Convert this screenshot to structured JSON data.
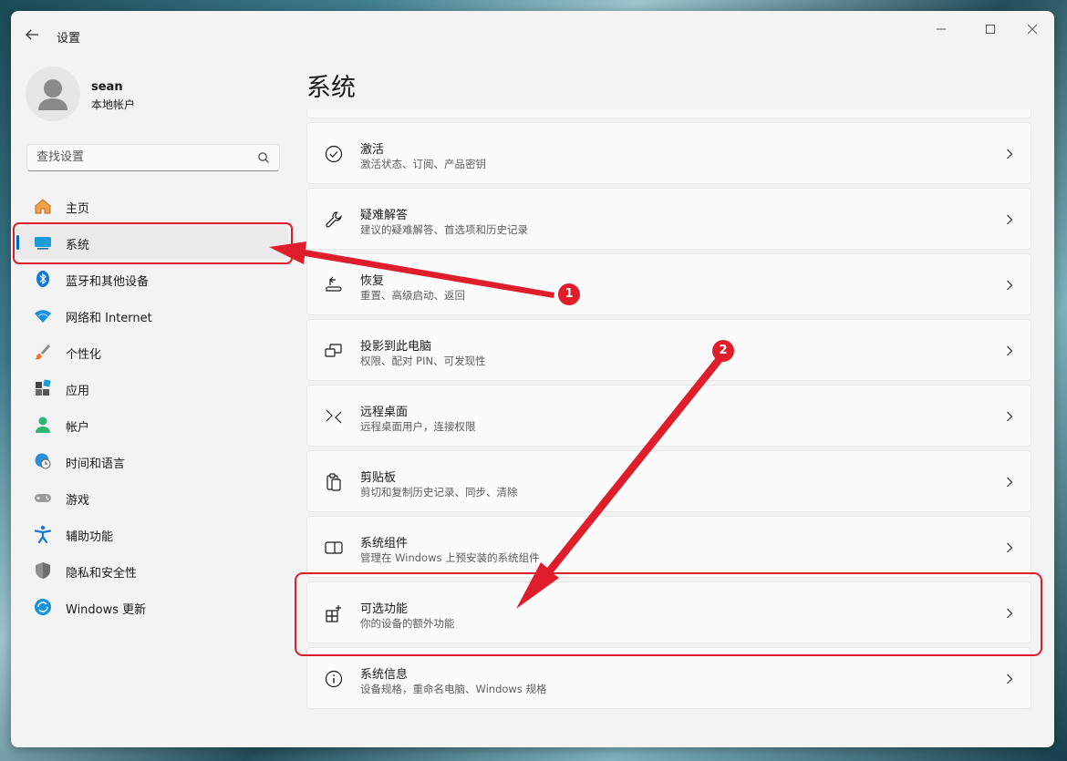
{
  "window": {
    "title": "设置",
    "back_icon": "arrow-left-icon",
    "controls": [
      "minimize-icon",
      "maximize-icon",
      "close-icon"
    ]
  },
  "profile": {
    "name": "sean",
    "account_type": "本地帐户",
    "avatar_icon": "person-icon"
  },
  "search": {
    "placeholder": "查找设置",
    "icon": "search-icon"
  },
  "sidebar": {
    "items": [
      {
        "label": "主页",
        "icon": "home-icon"
      },
      {
        "label": "系统",
        "icon": "monitor-icon",
        "selected": true
      },
      {
        "label": "蓝牙和其他设备",
        "icon": "bluetooth-icon"
      },
      {
        "label": "网络和 Internet",
        "icon": "wifi-icon"
      },
      {
        "label": "个性化",
        "icon": "brush-icon"
      },
      {
        "label": "应用",
        "icon": "apps-icon"
      },
      {
        "label": "帐户",
        "icon": "account-icon"
      },
      {
        "label": "时间和语言",
        "icon": "globe-clock-icon"
      },
      {
        "label": "游戏",
        "icon": "gamepad-icon"
      },
      {
        "label": "辅助功能",
        "icon": "accessibility-icon"
      },
      {
        "label": "隐私和安全性",
        "icon": "shield-icon"
      },
      {
        "label": "Windows 更新",
        "icon": "update-icon"
      }
    ]
  },
  "main": {
    "title": "系统",
    "cards": [
      {
        "title": "激活",
        "subtitle": "激活状态、订阅、产品密钥",
        "icon": "check-circle-icon"
      },
      {
        "title": "疑难解答",
        "subtitle": "建议的疑难解答、首选项和历史记录",
        "icon": "wrench-icon"
      },
      {
        "title": "恢复",
        "subtitle": "重置、高级启动、返回",
        "icon": "recovery-icon"
      },
      {
        "title": "投影到此电脑",
        "subtitle": "权限、配对 PIN、可发现性",
        "icon": "project-icon"
      },
      {
        "title": "远程桌面",
        "subtitle": "远程桌面用户，连接权限",
        "icon": "remote-desktop-icon"
      },
      {
        "title": "剪贴板",
        "subtitle": "剪切和复制历史记录、同步、清除",
        "icon": "clipboard-icon"
      },
      {
        "title": "系统组件",
        "subtitle": "管理在 Windows 上预安装的系统组件",
        "icon": "components-icon"
      },
      {
        "title": "可选功能",
        "subtitle": "你的设备的额外功能",
        "icon": "optional-features-icon"
      },
      {
        "title": "系统信息",
        "subtitle": "设备规格，重命名电脑、Windows 规格",
        "icon": "info-icon"
      }
    ]
  },
  "annotations": {
    "color": "#e01e2b",
    "steps": [
      "1",
      "2"
    ]
  }
}
